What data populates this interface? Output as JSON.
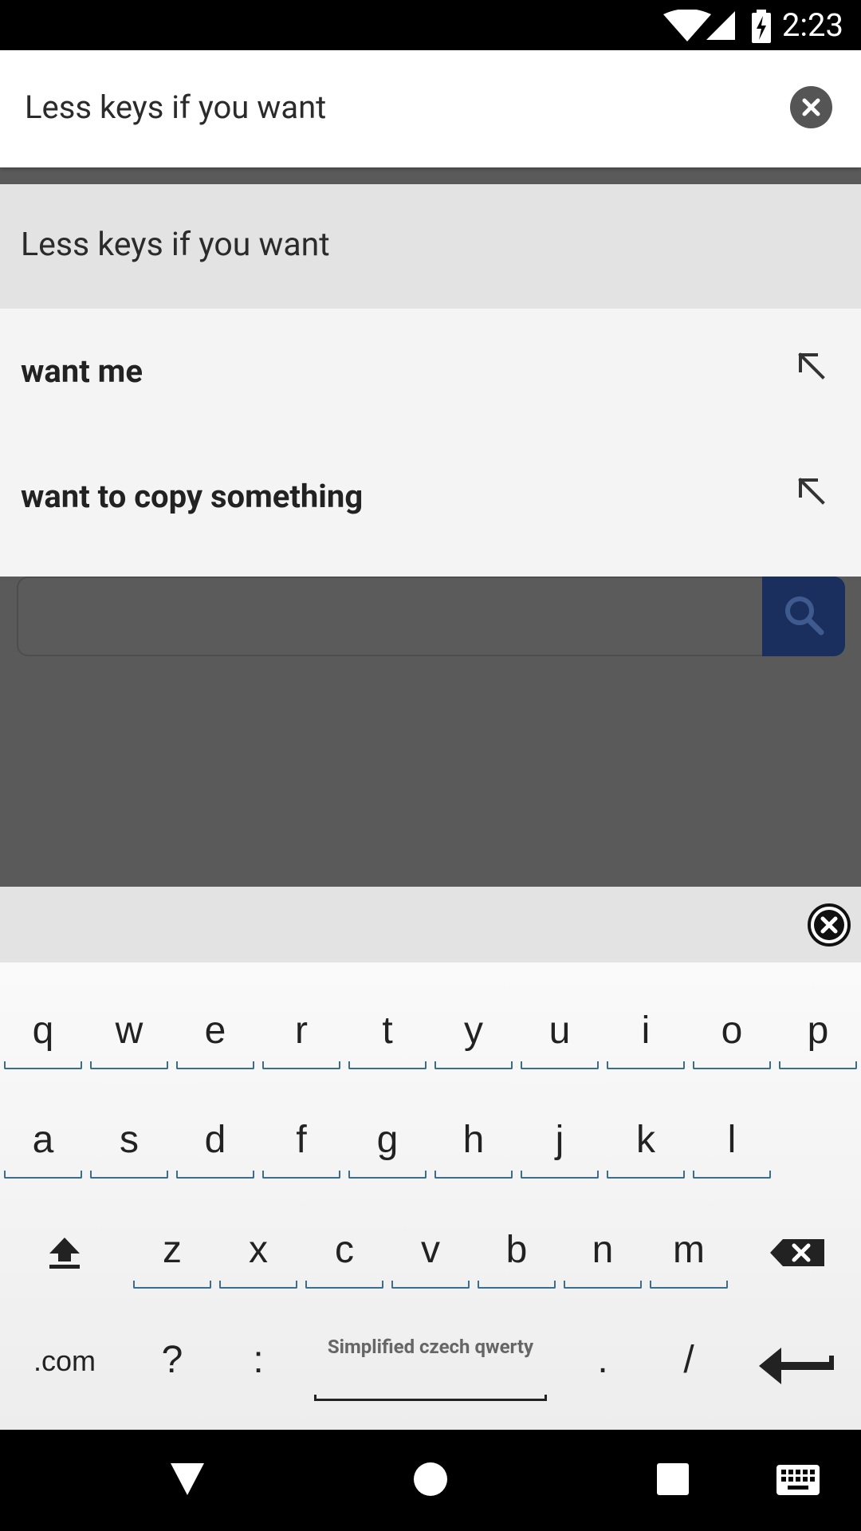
{
  "status_bar": {
    "time": "2:23"
  },
  "search": {
    "query": "Less keys if you want"
  },
  "suggestions": [
    {
      "text": "Less keys if you want"
    },
    {
      "text": "want me"
    },
    {
      "text": "want to copy something"
    }
  ],
  "keyboard": {
    "row1": [
      "q",
      "w",
      "e",
      "r",
      "t",
      "y",
      "u",
      "i",
      "o",
      "p"
    ],
    "row2": [
      "a",
      "s",
      "d",
      "f",
      "g",
      "h",
      "j",
      "k",
      "l"
    ],
    "row3": [
      "z",
      "x",
      "c",
      "v",
      "b",
      "n",
      "m"
    ],
    "row4": {
      "com": ".com",
      "question": "?",
      "colon": ":",
      "space_label": "Simplified czech qwerty",
      "period": ".",
      "slash": "/"
    }
  },
  "colors": {
    "page_search_button": "#1b2f5e",
    "key_underline": "#3a6e8c"
  }
}
